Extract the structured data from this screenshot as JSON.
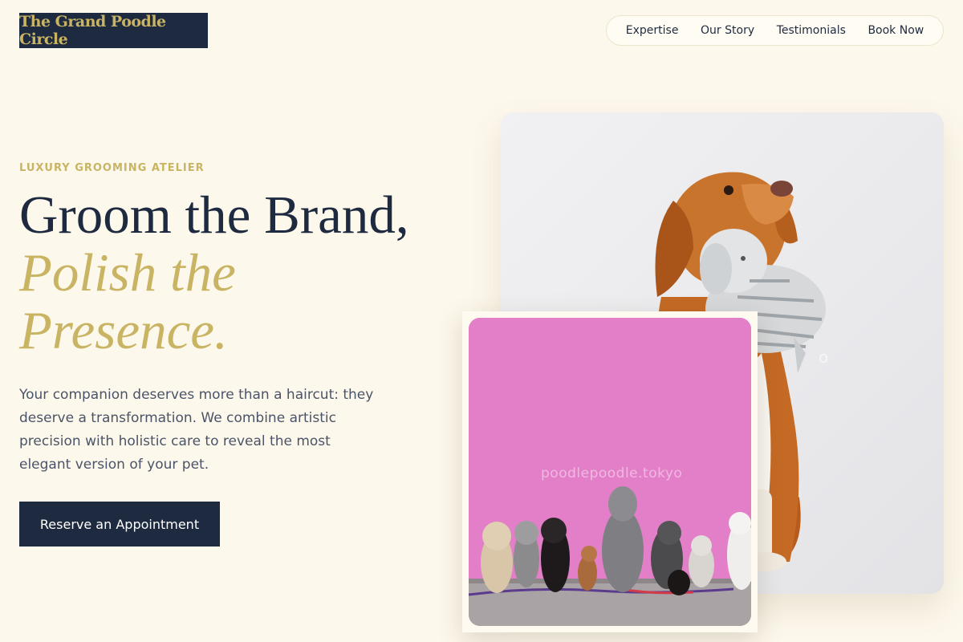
{
  "header": {
    "logo_text": "The Grand Poodle Circle",
    "nav": [
      {
        "label": "Expertise"
      },
      {
        "label": "Our Story"
      },
      {
        "label": "Testimonials"
      },
      {
        "label": "Book Now"
      }
    ]
  },
  "hero": {
    "eyebrow": "LUXURY GROOMING ATELIER",
    "headline_line1": "Groom the Brand,",
    "headline_accent_line1": "Polish the",
    "headline_accent_line2": "Presence.",
    "lede": "Your companion deserves more than a haircut: they deserve a transformation. We combine artistic precision with holistic care to reveal the most elegant version of your pet.",
    "cta_label": "Reserve an Appointment"
  },
  "images": {
    "back_image_watermark": "o",
    "front_image_watermark": "poodlepoodle.tokyo"
  },
  "colors": {
    "background": "#fdf8ec",
    "navy": "#1e2a3f",
    "gold": "#c9b464",
    "body_text": "#4a5468",
    "pink_wall": "#e37fc8"
  }
}
